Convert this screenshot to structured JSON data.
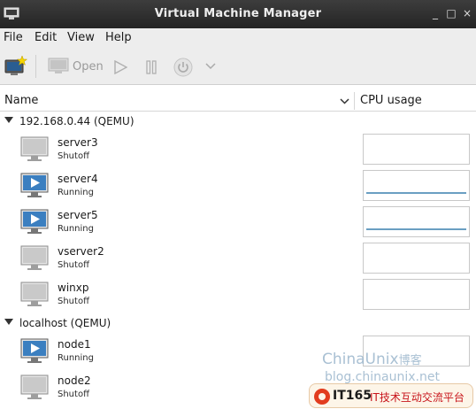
{
  "window": {
    "title": "Virtual Machine Manager",
    "controls": [
      "_",
      "□",
      "×"
    ]
  },
  "menu": [
    "File",
    "Edit",
    "View",
    "Help"
  ],
  "toolbar": {
    "open_label": "Open"
  },
  "columns": {
    "name": "Name",
    "cpu": "CPU usage"
  },
  "connections": [
    {
      "label": "192.168.0.44 (QEMU)",
      "vms": [
        {
          "name": "server3",
          "state": "Shutoff"
        },
        {
          "name": "server4",
          "state": "Running"
        },
        {
          "name": "server5",
          "state": "Running"
        },
        {
          "name": "vserver2",
          "state": "Shutoff"
        },
        {
          "name": "winxp",
          "state": "Shutoff"
        }
      ]
    },
    {
      "label": "localhost (QEMU)",
      "vms": [
        {
          "name": "node1",
          "state": "Running"
        },
        {
          "name": "node2",
          "state": "Shutoff"
        }
      ]
    }
  ],
  "watermark": {
    "line1": "ChinaUnix",
    "line1_suffix": "博客",
    "line2": "blog.chinaunix.net",
    "badge_a": "IT165",
    "badge_b": "IT技术互动交流平台"
  },
  "colors": {
    "running_accent": "#3b7fc0",
    "shutoff_screen": "#c9c9c9",
    "cpu_line": "#6a9fc2"
  }
}
